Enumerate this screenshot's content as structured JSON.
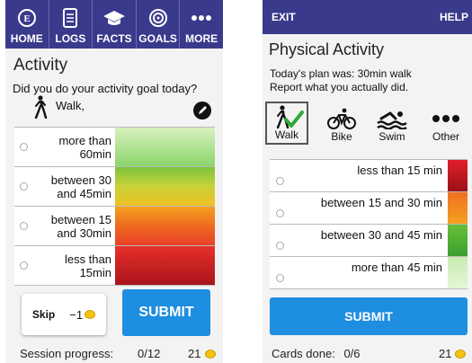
{
  "screen1": {
    "nav": [
      {
        "label": "HOME",
        "icon": "home-icon"
      },
      {
        "label": "LOGS",
        "icon": "logs-icon"
      },
      {
        "label": "FACTS",
        "icon": "facts-icon"
      },
      {
        "label": "GOALS",
        "icon": "goals-icon"
      },
      {
        "label": "MORE",
        "icon": "more-icon"
      }
    ],
    "title": "Activity",
    "question": "Did you do your activity goal today?",
    "activity_label": "Walk,",
    "options": [
      {
        "label": "more than 60min"
      },
      {
        "label": "between 30 and 45min"
      },
      {
        "label": "between 15 and 30min"
      },
      {
        "label": "less than 15min"
      }
    ],
    "skip": {
      "label": "Skip",
      "penalty": "−1"
    },
    "submit_label": "SUBMIT",
    "status": {
      "label": "Session progress:",
      "progress": "0/12",
      "coins": "21"
    }
  },
  "screen2": {
    "exit_label": "EXIT",
    "help_label": "HELP",
    "title": "Physical Activity",
    "plan_line1": "Today's plan was: 30min walk",
    "plan_line2": "Report what you actually did.",
    "activities": [
      {
        "label": "Walk",
        "icon": "walk-icon",
        "selected": true
      },
      {
        "label": "Bike",
        "icon": "bike-icon"
      },
      {
        "label": "Swim",
        "icon": "swim-icon"
      },
      {
        "label": "Other",
        "icon": "more-icon"
      }
    ],
    "options": [
      {
        "label": "less than 15 min"
      },
      {
        "label": "between 15 and 30 min"
      },
      {
        "label": "between 30 and 45 min"
      },
      {
        "label": "more than 45 min"
      }
    ],
    "submit_label": "SUBMIT",
    "status": {
      "label": "Cards done:",
      "progress": "0/6",
      "coins": "21"
    }
  },
  "colors": {
    "nav_bg": "#3a3a8c",
    "submit_bg": "#1e8ee0",
    "coin": "#f2c40f",
    "check_green": "#2eaa3a"
  }
}
